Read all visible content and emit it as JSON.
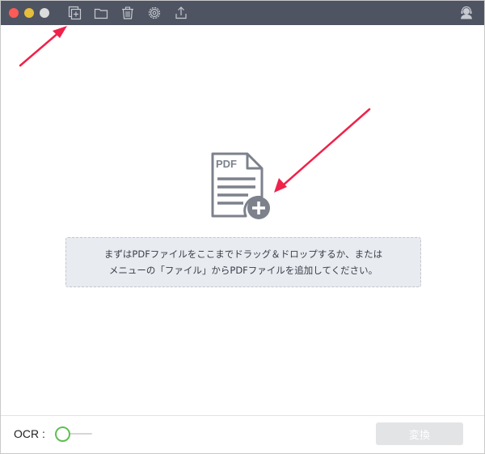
{
  "titlebar": {
    "traffic_lights": [
      "close",
      "minimize",
      "zoom"
    ],
    "toolbar_icons": [
      "add-file-icon",
      "folder-icon",
      "trash-icon",
      "settings-icon",
      "export-icon"
    ],
    "right_icon": "user-support-icon",
    "background_color": "#4f5462"
  },
  "drop_area": {
    "icon_text": "PDF",
    "line1": "まずはPDFファイルをここまでドラッグ＆ドロップするか、または",
    "line2": "メニューの「ファイル」からPDFファイルを追加してください。"
  },
  "footer": {
    "ocr_label": "OCR :",
    "ocr_enabled": false,
    "convert_label": "変換",
    "convert_enabled": false
  },
  "annotations": {
    "arrow_color": "#f0224a",
    "arrows": 2
  }
}
